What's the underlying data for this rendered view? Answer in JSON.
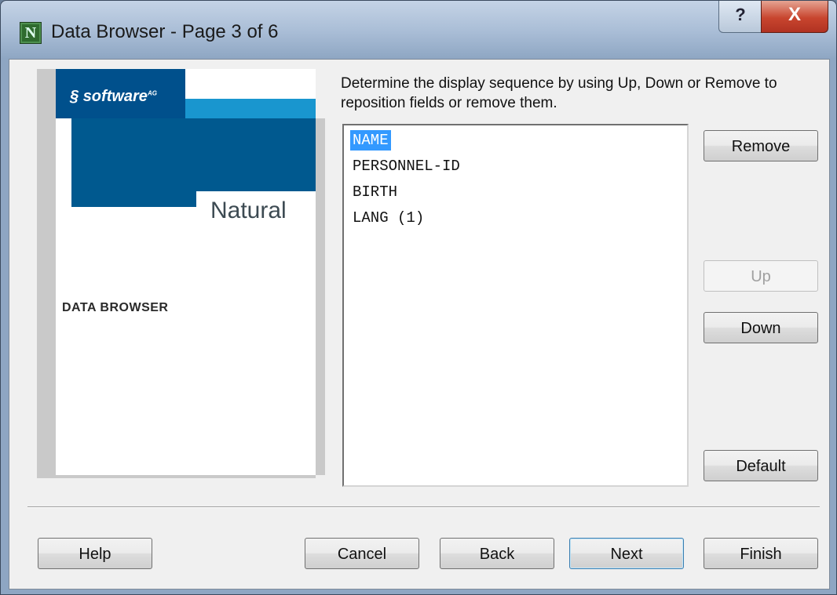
{
  "window": {
    "title": "Data Browser - Page 3 of 6",
    "app_icon_glyph": "N",
    "help_glyph": "?",
    "close_glyph": "X"
  },
  "banner": {
    "logo_text": "software",
    "logo_sup": "AG",
    "product": "Natural",
    "section": "DATA BROWSER",
    "colors": {
      "dark_blue": "#00598f",
      "cyan": "#1996cf"
    }
  },
  "instructions": "Determine the display sequence by using Up, Down or Remove to reposition fields or remove them.",
  "fields": [
    "NAME",
    "PERSONNEL-ID",
    "BIRTH",
    "LANG (1)"
  ],
  "selected_field": "NAME",
  "side_buttons": {
    "remove": "Remove",
    "up": "Up",
    "down": "Down",
    "default": "Default"
  },
  "footer_buttons": {
    "help": "Help",
    "cancel": "Cancel",
    "back": "Back",
    "next": "Next",
    "finish": "Finish"
  }
}
